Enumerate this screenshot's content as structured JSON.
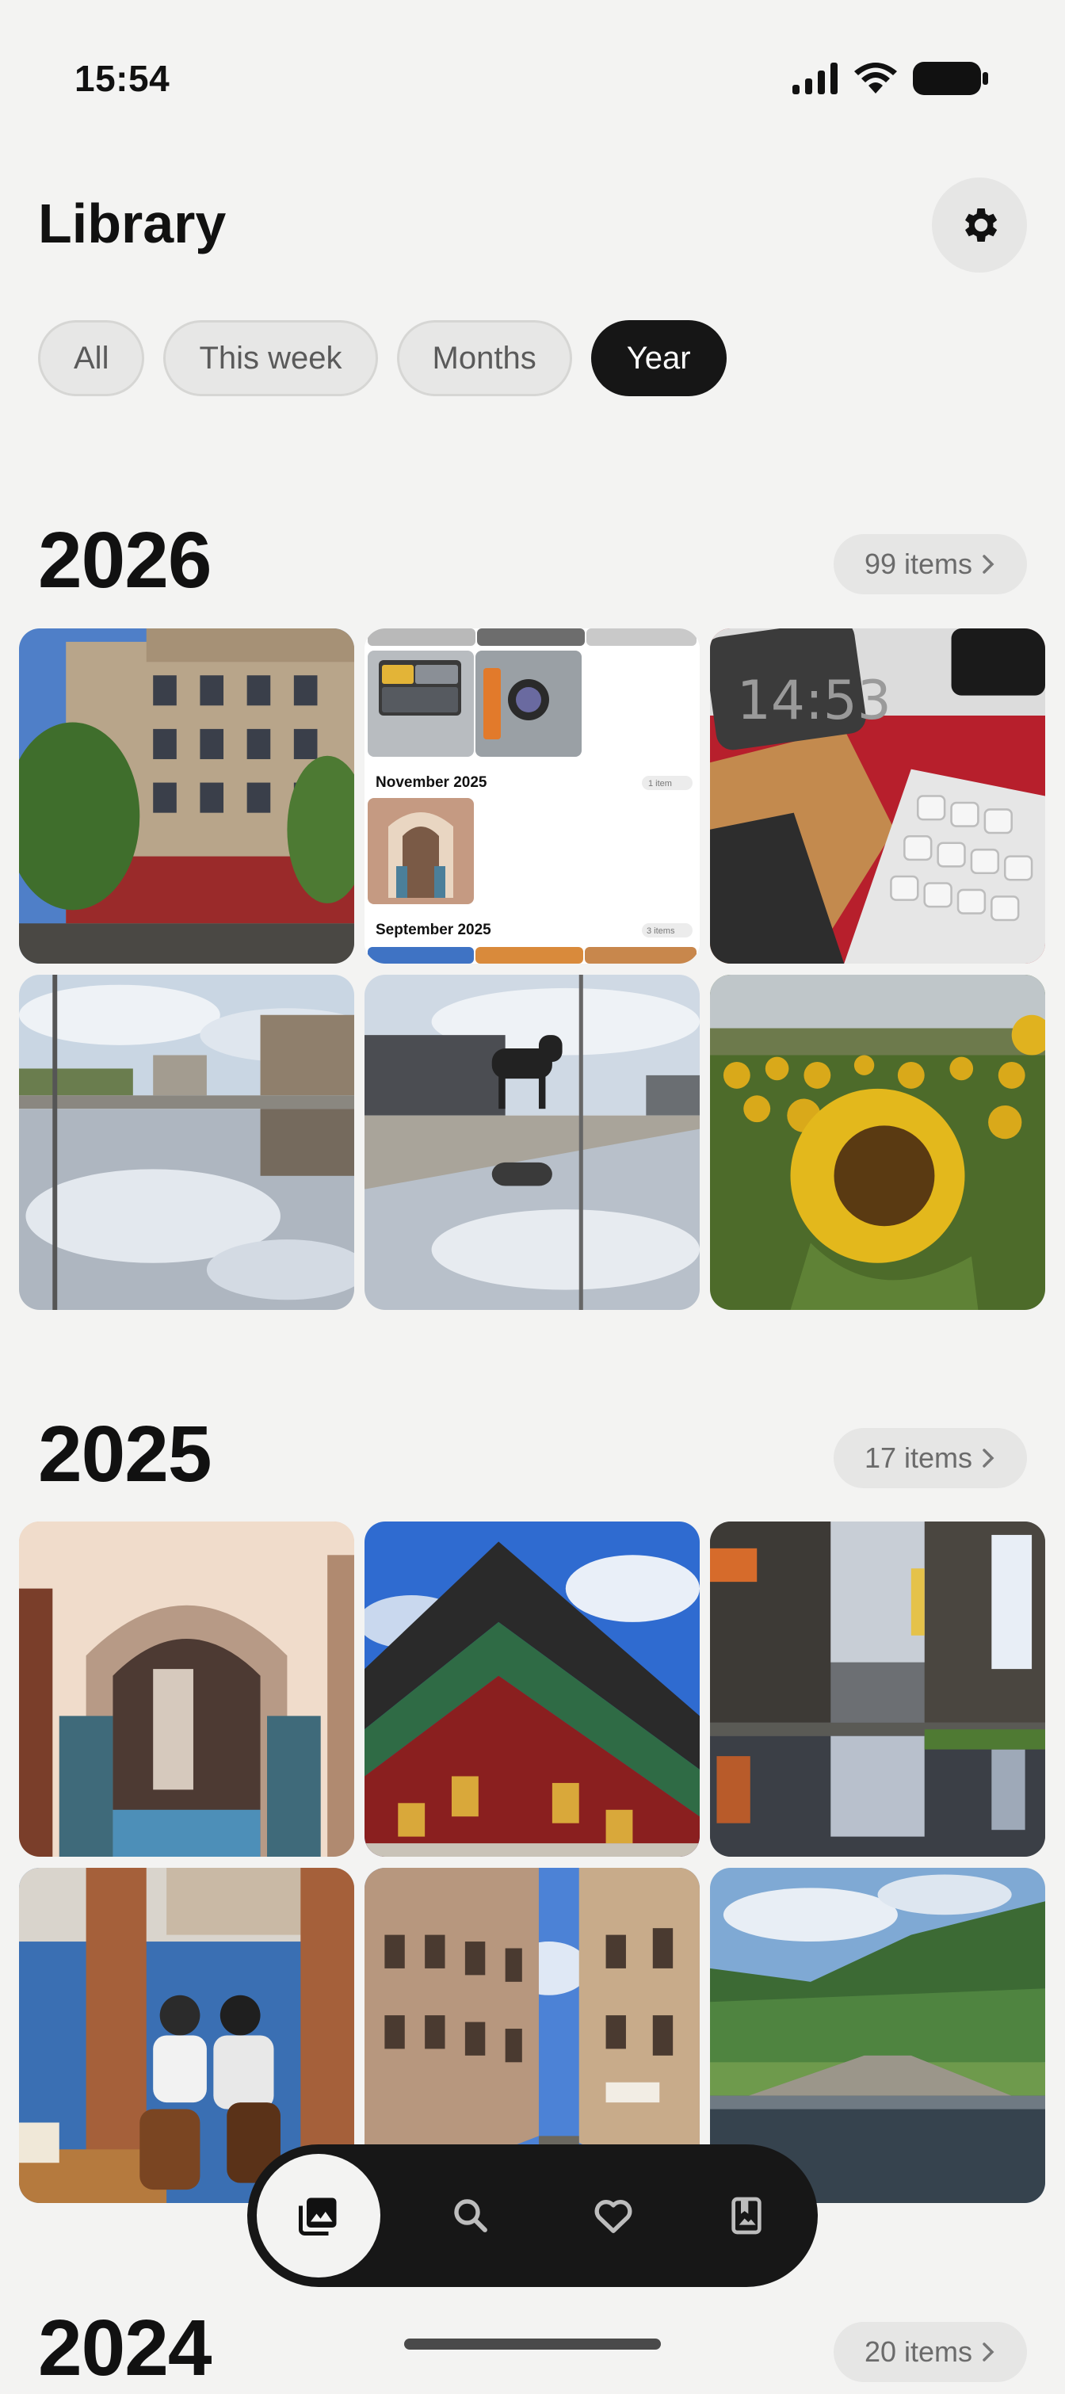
{
  "status_bar": {
    "time": "15:54"
  },
  "header": {
    "title": "Library"
  },
  "filters": [
    {
      "label": "All"
    },
    {
      "label": "This week"
    },
    {
      "label": "Months"
    },
    {
      "label": "Year"
    }
  ],
  "active_filter": "Year",
  "sections": [
    {
      "year": "2026",
      "count_label": "99 items",
      "inner_preview": {
        "headings": [
          "November 2025",
          "September 2025"
        ],
        "counts": [
          "1 item",
          "3 items"
        ]
      }
    },
    {
      "year": "2025",
      "count_label": "17 items"
    },
    {
      "year": "2024",
      "count_label": "20 items"
    }
  ],
  "bottom_nav": [
    {
      "icon": "photos-icon",
      "active": true
    },
    {
      "icon": "search-icon",
      "active": false
    },
    {
      "icon": "heart-icon",
      "active": false
    },
    {
      "icon": "bookmark-icon",
      "active": false
    }
  ],
  "colors": {
    "accent_dark": "#161616",
    "background": "#f3f3f2",
    "chip_bg": "#e7e7e6"
  }
}
